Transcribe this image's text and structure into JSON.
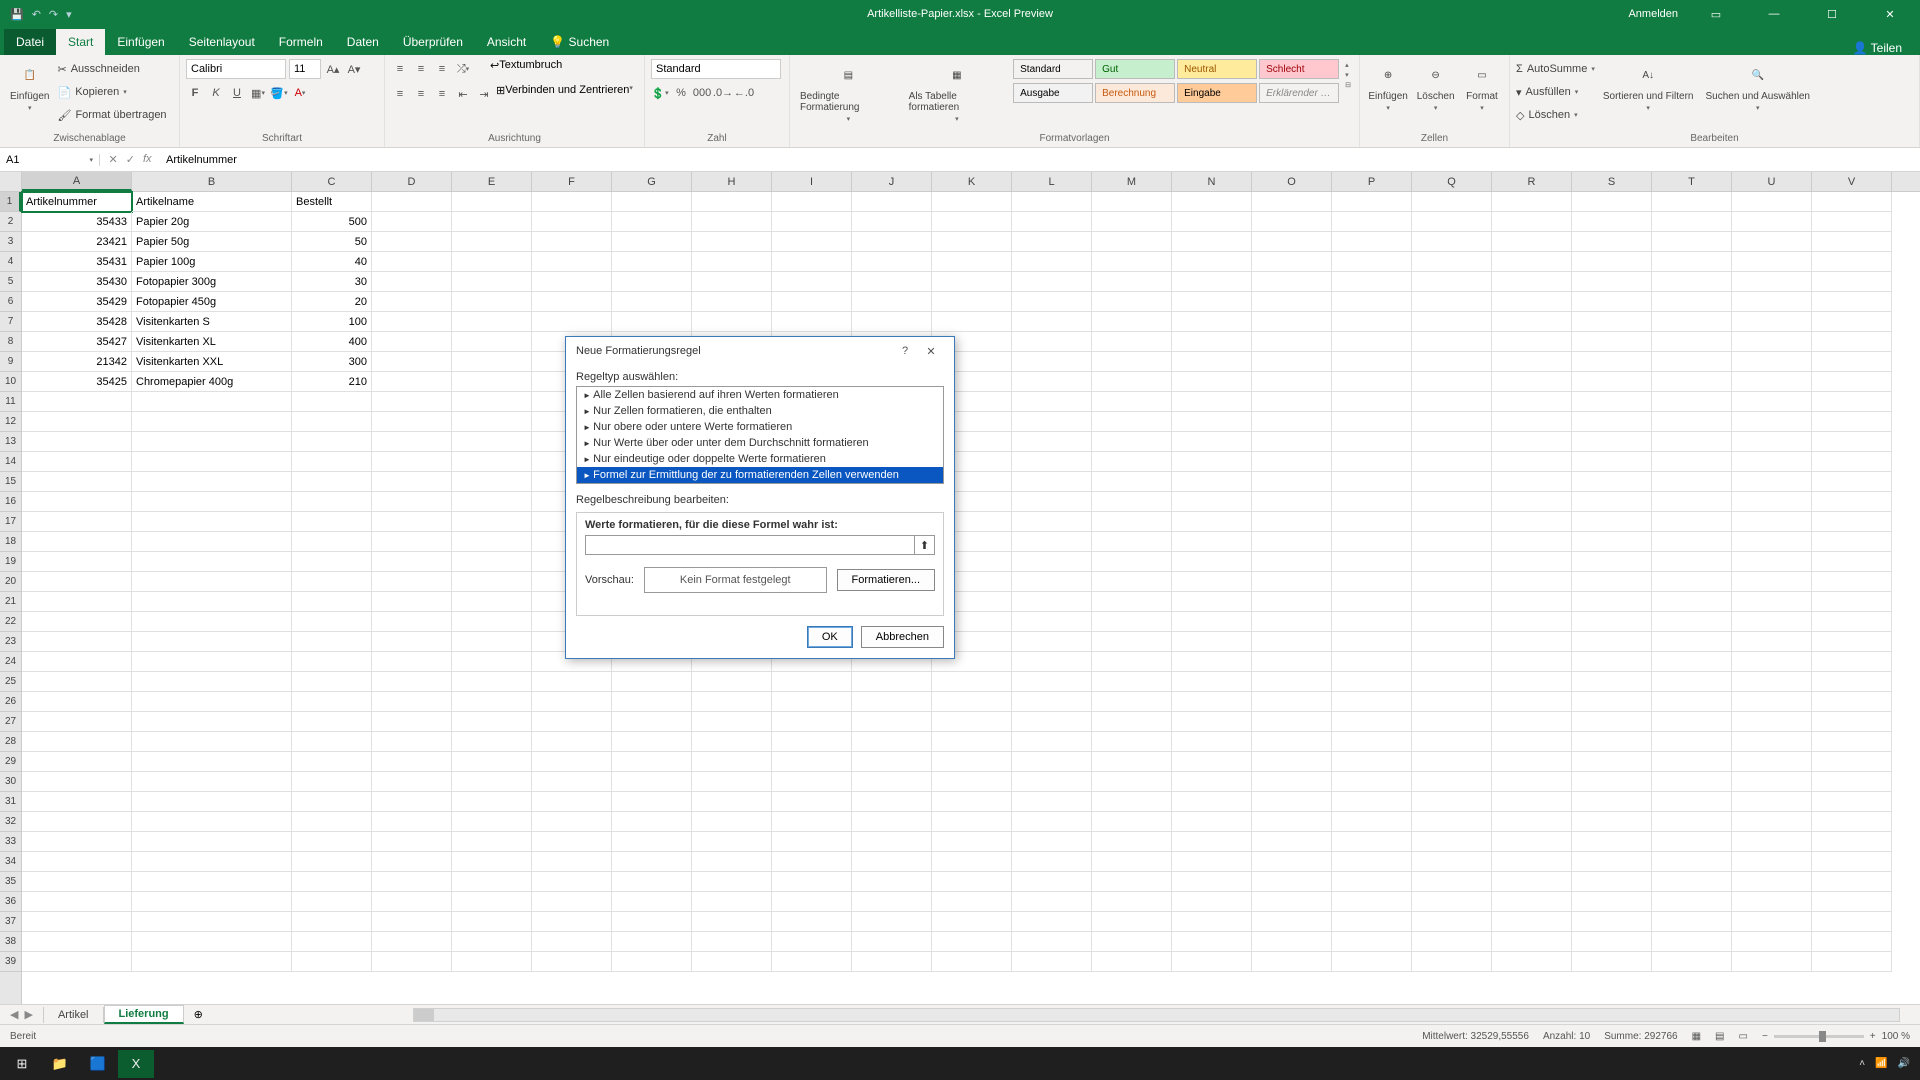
{
  "titlebar": {
    "filename": "Artikelliste-Papier.xlsx - Excel Preview",
    "signin": "Anmelden"
  },
  "tabs": {
    "file": "Datei",
    "items": [
      "Start",
      "Einfügen",
      "Seitenlayout",
      "Formeln",
      "Daten",
      "Überprüfen",
      "Ansicht"
    ],
    "search": "Suchen",
    "share": "Teilen"
  },
  "ribbon": {
    "clipboard": {
      "paste": "Einfügen",
      "cut": "Ausschneiden",
      "copy": "Kopieren",
      "formatpainter": "Format übertragen",
      "label": "Zwischenablage"
    },
    "font": {
      "name": "Calibri",
      "size": "11",
      "label": "Schriftart"
    },
    "alignment": {
      "wrap": "Textumbruch",
      "merge": "Verbinden und Zentrieren",
      "label": "Ausrichtung"
    },
    "number": {
      "format": "Standard",
      "label": "Zahl"
    },
    "styles": {
      "conditional": "Bedingte Formatierung",
      "astable": "Als Tabelle formatieren",
      "s1": "Standard",
      "s2": "Gut",
      "s3": "Neutral",
      "s4": "Schlecht",
      "s5": "Ausgabe",
      "s6": "Berechnung",
      "s7": "Eingabe",
      "s8": "Erklärender …",
      "label": "Formatvorlagen"
    },
    "cells": {
      "insert": "Einfügen",
      "delete": "Löschen",
      "format": "Format",
      "label": "Zellen"
    },
    "editing": {
      "autosum": "AutoSumme",
      "fill": "Ausfüllen",
      "clear": "Löschen",
      "sort": "Sortieren und Filtern",
      "find": "Suchen und Auswählen",
      "label": "Bearbeiten"
    }
  },
  "fx": {
    "namebox": "A1",
    "formula": "Artikelnummer"
  },
  "columns": {
    "labels": [
      "A",
      "B",
      "C",
      "D",
      "E",
      "F",
      "G",
      "H",
      "I",
      "J",
      "K",
      "L",
      "M",
      "N",
      "O",
      "P",
      "Q",
      "R",
      "S",
      "T",
      "U",
      "V"
    ],
    "widths": [
      110,
      160,
      80,
      80,
      80,
      80,
      80,
      80,
      80,
      80,
      80,
      80,
      80,
      80,
      80,
      80,
      80,
      80,
      80,
      80,
      80,
      80
    ]
  },
  "rows": 39,
  "data": {
    "headers": [
      "Artikelnummer",
      "Artikelname",
      "Bestellt"
    ],
    "rows": [
      [
        "35433",
        "Papier 20g",
        "500"
      ],
      [
        "23421",
        "Papier 50g",
        "50"
      ],
      [
        "35431",
        "Papier 100g",
        "40"
      ],
      [
        "35430",
        "Fotopapier 300g",
        "30"
      ],
      [
        "35429",
        "Fotopapier 450g",
        "20"
      ],
      [
        "35428",
        "Visitenkarten S",
        "100"
      ],
      [
        "35427",
        "Visitenkarten XL",
        "400"
      ],
      [
        "21342",
        "Visitenkarten XXL",
        "300"
      ],
      [
        "35425",
        "Chromepapier 400g",
        "210"
      ]
    ]
  },
  "sheets": {
    "s1": "Artikel",
    "s2": "Lieferung"
  },
  "status": {
    "ready": "Bereit",
    "avg_label": "Mittelwert:",
    "avg": "32529,55556",
    "count_label": "Anzahl:",
    "count": "10",
    "sum_label": "Summe:",
    "sum": "292766",
    "zoom": "100 %"
  },
  "dialog": {
    "title": "Neue Formatierungsregel",
    "select_label": "Regeltyp auswählen:",
    "rules": [
      "Alle Zellen basierend auf ihren Werten formatieren",
      "Nur Zellen formatieren, die enthalten",
      "Nur obere oder untere Werte formatieren",
      "Nur Werte über oder unter dem Durchschnitt formatieren",
      "Nur eindeutige oder doppelte Werte formatieren",
      "Formel zur Ermittlung der zu formatierenden Zellen verwenden"
    ],
    "selected_rule_index": 5,
    "desc_label": "Regelbeschreibung bearbeiten:",
    "formula_label": "Werte formatieren, für die diese Formel wahr ist:",
    "formula_value": "",
    "preview_label": "Vorschau:",
    "preview_text": "Kein Format festgelegt",
    "format_btn": "Formatieren...",
    "ok": "OK",
    "cancel": "Abbrechen"
  }
}
